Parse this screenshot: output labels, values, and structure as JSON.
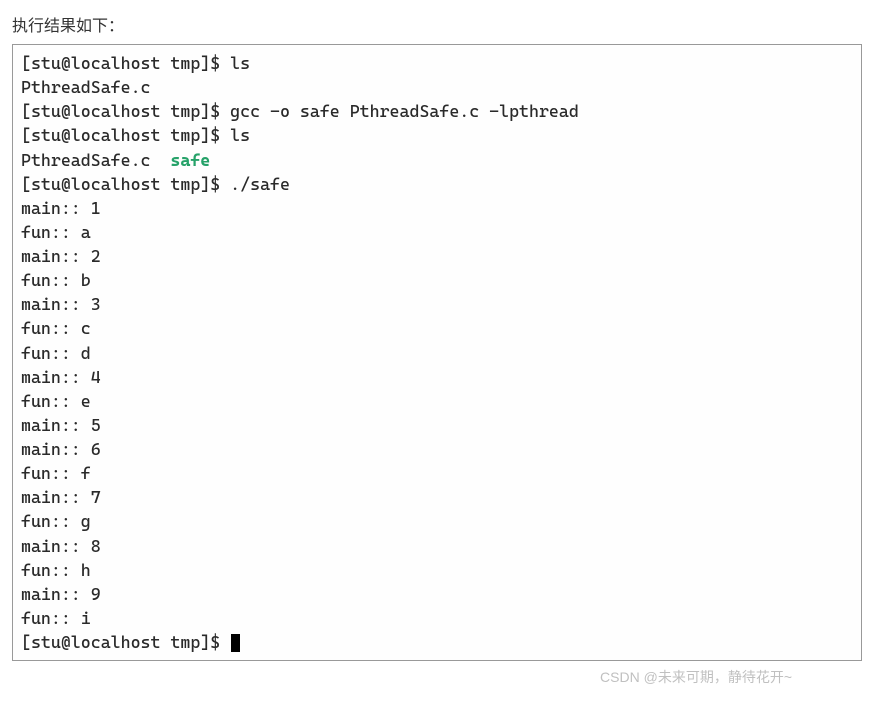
{
  "caption": "执行结果如下：",
  "terminal": {
    "lines": [
      {
        "segments": [
          {
            "text": "[stu@localhost tmp]$ ls"
          }
        ]
      },
      {
        "segments": [
          {
            "text": "PthreadSafe.c"
          }
        ]
      },
      {
        "segments": [
          {
            "text": "[stu@localhost tmp]$ gcc -o safe PthreadSafe.c -lpthread"
          }
        ]
      },
      {
        "segments": [
          {
            "text": "[stu@localhost tmp]$ ls"
          }
        ]
      },
      {
        "segments": [
          {
            "text": "PthreadSafe.c  "
          },
          {
            "text": "safe",
            "class": "green"
          }
        ]
      },
      {
        "segments": [
          {
            "text": "[stu@localhost tmp]$ ./safe"
          }
        ]
      },
      {
        "segments": [
          {
            "text": "main:: 1"
          }
        ]
      },
      {
        "segments": [
          {
            "text": "fun:: a"
          }
        ]
      },
      {
        "segments": [
          {
            "text": "main:: 2"
          }
        ]
      },
      {
        "segments": [
          {
            "text": "fun:: b"
          }
        ]
      },
      {
        "segments": [
          {
            "text": "main:: 3"
          }
        ]
      },
      {
        "segments": [
          {
            "text": "fun:: c"
          }
        ]
      },
      {
        "segments": [
          {
            "text": "fun:: d"
          }
        ]
      },
      {
        "segments": [
          {
            "text": "main:: 4"
          }
        ]
      },
      {
        "segments": [
          {
            "text": "fun:: e"
          }
        ]
      },
      {
        "segments": [
          {
            "text": "main:: 5"
          }
        ]
      },
      {
        "segments": [
          {
            "text": "main:: 6"
          }
        ]
      },
      {
        "segments": [
          {
            "text": "fun:: f"
          }
        ]
      },
      {
        "segments": [
          {
            "text": "main:: 7"
          }
        ]
      },
      {
        "segments": [
          {
            "text": "fun:: g"
          }
        ]
      },
      {
        "segments": [
          {
            "text": "main:: 8"
          }
        ]
      },
      {
        "segments": [
          {
            "text": "fun:: h"
          }
        ]
      },
      {
        "segments": [
          {
            "text": "main:: 9"
          }
        ]
      },
      {
        "segments": [
          {
            "text": "fun:: i"
          }
        ]
      },
      {
        "segments": [
          {
            "text": "[stu@localhost tmp]$ "
          }
        ],
        "cursor": true
      }
    ]
  },
  "watermark": "CSDN @未来可期，静待花开~"
}
